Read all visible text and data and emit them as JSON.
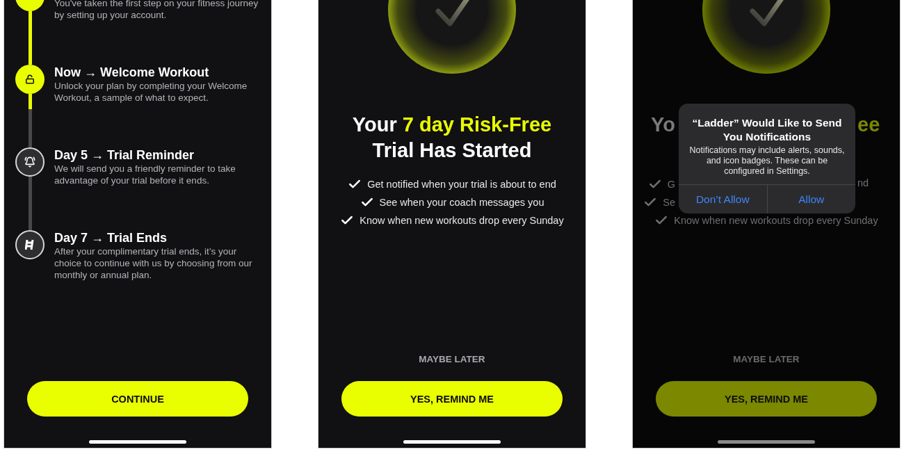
{
  "screens": [
    {
      "kind": "timeline",
      "dimmed": false,
      "steps": [
        {
          "completed": true,
          "description": "You've taken the first step on your fitness journey by setting up your account."
        },
        {
          "completed": true,
          "title": "Now → Welcome Workout",
          "description": "Unlock your plan by completing your Welcome Workout, a sample of what to expect."
        },
        {
          "completed": false,
          "title": "Day 5 → Trial Reminder",
          "description": "We will send you a friendly reminder to take advantage of your trial before it ends."
        },
        {
          "completed": false,
          "title": "Day 7 → Trial Ends",
          "description": "After your complimentary trial ends, it’s your choice to continue with us by choosing from our monthly or annual plan."
        }
      ],
      "primary_button": "CONTINUE"
    },
    {
      "kind": "confirmation",
      "dimmed": false,
      "headline": [
        {
          "obscured": false,
          "parts": [
            {
              "text": "Your ",
              "highlight": false
            },
            {
              "text": "7 day Risk-Free",
              "highlight": true
            }
          ]
        },
        {
          "obscured": false,
          "parts": [
            {
              "text": "Trial Has Started",
              "highlight": false
            }
          ]
        }
      ],
      "benefits": [
        {
          "obscured": false,
          "parts": [
            "Get notified when your trial is about to end"
          ]
        },
        {
          "obscured": false,
          "parts": [
            "See when your coach messages you"
          ]
        },
        {
          "obscured": false,
          "parts": [
            "Know when new workouts drop every Sunday"
          ]
        }
      ],
      "secondary_button": "MAYBE LATER",
      "primary_button": "YES, REMIND ME"
    },
    {
      "kind": "confirmation",
      "dimmed": true,
      "headline": [
        {
          "obscured": true,
          "parts": [
            {
              "text": "Yo",
              "highlight": false
            },
            {
              "text": "ee",
              "highlight": true
            }
          ]
        }
      ],
      "benefits": [
        {
          "obscured": true,
          "parts": [
            "G",
            "nd"
          ]
        },
        {
          "obscured": true,
          "parts": [
            "Se"
          ]
        },
        {
          "obscured": false,
          "parts": [
            "Know when new workouts drop every Sunday"
          ]
        }
      ],
      "secondary_button": "MAYBE LATER",
      "primary_button": "YES, REMIND ME",
      "alert": {
        "title": "“Ladder” Would Like to Send You Notifications",
        "message": "Notifications may include alerts, sounds, and icon badges. These can be configured in Settings.",
        "buttons": [
          "Don’t Allow",
          "Allow"
        ]
      }
    }
  ]
}
